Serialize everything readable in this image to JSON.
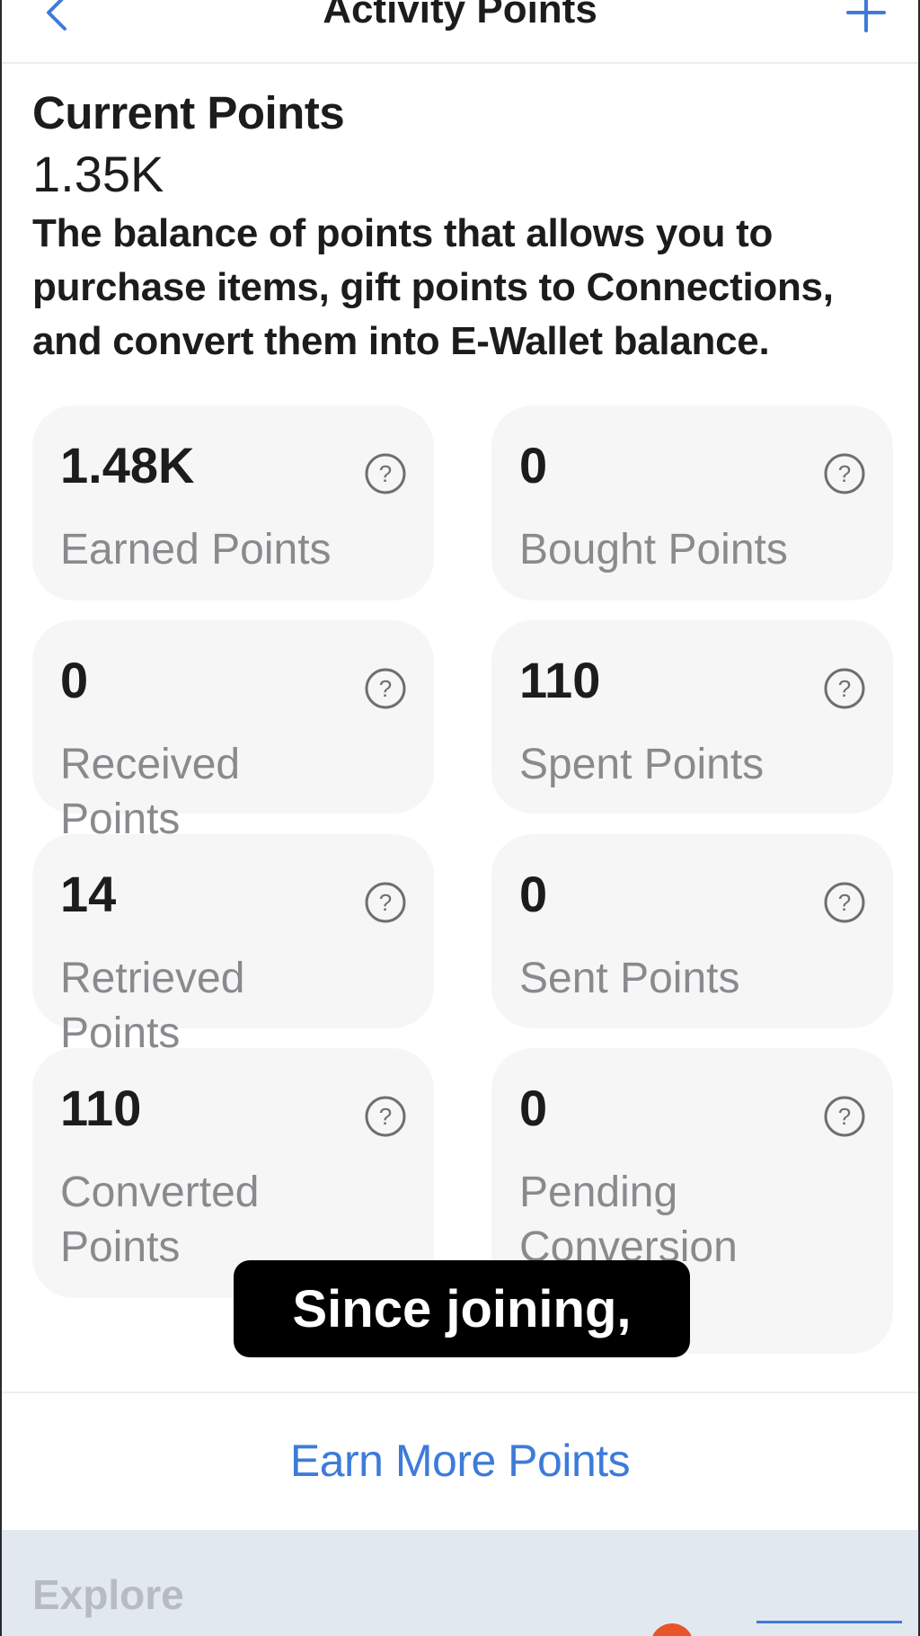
{
  "nav": {
    "title": "Activity Points",
    "back_icon": "chevron-left-icon",
    "add_icon": "plus-icon",
    "accent": "#3d7bd9"
  },
  "current": {
    "heading": "Current Points",
    "value": "1.35K",
    "description": "The balance of points that allows you to purchase items, gift points to Connections, and convert them into E-Wallet balance."
  },
  "cards": [
    {
      "value": "1.48K",
      "label": "Earned Points"
    },
    {
      "value": "0",
      "label": "Bought Points"
    },
    {
      "value": "0",
      "label": "Received Points"
    },
    {
      "value": "110",
      "label": "Spent Points"
    },
    {
      "value": "14",
      "label": "Retrieved Points"
    },
    {
      "value": "0",
      "label": "Sent Points"
    },
    {
      "value": "110",
      "label": "Converted Points"
    },
    {
      "value": "0",
      "label": "Pending Conversion"
    }
  ],
  "caption": "Since joining,",
  "actions": {
    "earn_more": "Earn More Points"
  },
  "explore": {
    "label": "Explore"
  }
}
